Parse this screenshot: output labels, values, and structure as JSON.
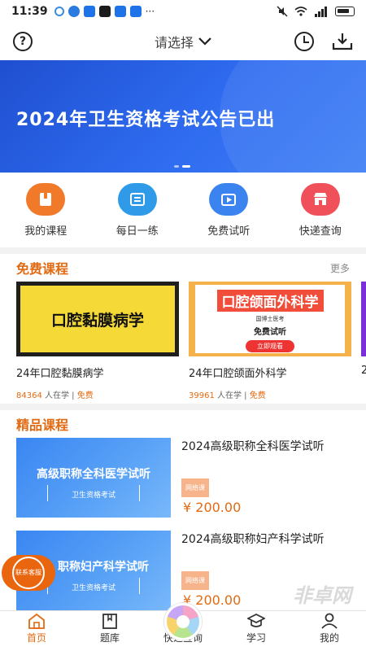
{
  "status_bar": {
    "time": "11:39",
    "dots": "···"
  },
  "header": {
    "selector_label": "请选择",
    "selector_chevron": "chevron-down-icon"
  },
  "banner": {
    "title": "2024年卫生资格考试公告已出"
  },
  "quick_nav": [
    {
      "label": "我的课程",
      "icon": "book-icon",
      "color": "#f07a2a"
    },
    {
      "label": "每日一练",
      "icon": "practice-icon",
      "color": "#2f9be8"
    },
    {
      "label": "免费试听",
      "icon": "video-icon",
      "color": "#3b84f0"
    },
    {
      "label": "快递查询",
      "icon": "store-icon",
      "color": "#f0505a"
    }
  ],
  "free_section": {
    "title": "免费课程",
    "more": "更多",
    "courses": [
      {
        "thumb_title": "口腔黏膜病学",
        "name": "24年口腔黏膜病学",
        "count": "84364",
        "count_suffix": " 人在学",
        "sep": " | ",
        "tag": "免费"
      },
      {
        "thumb_title": "口腔颌面外科学",
        "thumb_small": "国博士医考",
        "thumb_tag": "免费试听",
        "thumb_btn": "立即观看",
        "name": "24年口腔颌面外科学",
        "count": "39961",
        "count_suffix": " 人在学",
        "sep": " | ",
        "tag": "免费"
      },
      {
        "name": "2"
      }
    ]
  },
  "premium_section": {
    "title": "精品课程",
    "courses": [
      {
        "thumb_title": "高级职称全科医学试听",
        "thumb_sub": "卫生资格考试",
        "title": "2024高级职称全科医学试听",
        "badge": "网络课",
        "price": "¥ 200.00"
      },
      {
        "thumb_title": "职称妇产科学试听",
        "thumb_sub": "卫生资格考试",
        "title": "2024高级职称妇产科学试听",
        "badge": "网络课",
        "price": "¥ 200.00"
      }
    ]
  },
  "float_cs": {
    "label": "联系客服"
  },
  "tab_bar": [
    {
      "label": "首页",
      "icon": "home-icon",
      "active": true
    },
    {
      "label": "题库",
      "icon": "question-bank-icon",
      "active": false
    },
    {
      "label": "快递查询",
      "icon": "express-query-icon",
      "active": false
    },
    {
      "label": "学习",
      "icon": "graduation-cap-icon",
      "active": false
    },
    {
      "label": "我的",
      "icon": "user-icon",
      "active": false
    }
  ],
  "watermark": "非卓网",
  "colors": {
    "accent": "#e26a12",
    "banner": "#2f6cf0"
  }
}
